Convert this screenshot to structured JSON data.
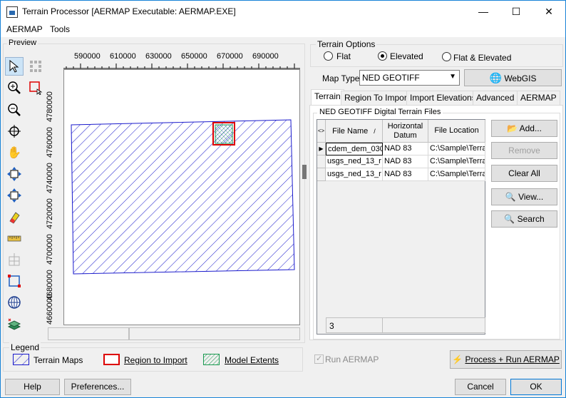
{
  "window": {
    "title": "Terrain Processor [AERMAP Executable: AERMAP.EXE]",
    "minimize": "—",
    "maximize": "☐",
    "close": "✕"
  },
  "menu": {
    "items": [
      "AERMAP",
      "Tools"
    ]
  },
  "preview": {
    "label": "Preview",
    "x_ticks": [
      "590000",
      "610000",
      "630000",
      "650000",
      "670000",
      "690000"
    ],
    "y_ticks": [
      "4780000",
      "4760000",
      "4740000",
      "4720000",
      "4700000",
      "4680000",
      "4660000"
    ],
    "tools": [
      "pointer-icon",
      "select-grid-icon",
      "zoom-in-icon",
      "region-select-icon",
      "zoom-out-icon",
      "crosshair-icon",
      "pan-icon",
      "move-icon",
      "resize-icon",
      "eraser-icon",
      "ruler-icon",
      "grid-disabled-icon",
      "bounds-icon",
      "globe-icon",
      "layers-icon"
    ]
  },
  "legend": {
    "label": "Legend",
    "terrain_maps": "Terrain Maps",
    "region_to_import": "Region to Import",
    "model_extents": "Model Extents"
  },
  "terrain_options": {
    "label": "Terrain Options",
    "flat": "Flat",
    "elevated": "Elevated",
    "flat_elevated": "Flat & Elevated",
    "selected": "Elevated"
  },
  "map_type": {
    "label": "Map Type:",
    "value": "NED GEOTIFF"
  },
  "webgis_label": "WebGIS",
  "tabs": [
    "Terrain",
    "Region To Import",
    "Import Elevations",
    "Advanced",
    "AERMAP"
  ],
  "files_group": {
    "label": "NED GEOTIFF Digital Terrain Files",
    "headers": {
      "corner": "<>",
      "file_name": "File Name",
      "sort": "/",
      "datum": "Horizontal Datum",
      "location": "File Location"
    },
    "rows": [
      {
        "name": "cdem_dem_030",
        "datum": "NAD 83",
        "location": "C:\\Sample\\Terra"
      },
      {
        "name": "usgs_ned_13_r",
        "datum": "NAD 83",
        "location": "C:\\Sample\\Terra"
      },
      {
        "name": "usgs_ned_13_r",
        "datum": "NAD 83",
        "location": "C:\\Sample\\Terra"
      }
    ],
    "count": "3"
  },
  "side_buttons": {
    "add": "Add...",
    "remove": "Remove",
    "clear_all": "Clear All",
    "view": "View...",
    "search": "Search"
  },
  "run_aermap": "Run AERMAP",
  "process_run": "Process + Run AERMAP",
  "bottom": {
    "help": "Help",
    "preferences": "Preferences...",
    "cancel": "Cancel",
    "ok": "OK"
  }
}
